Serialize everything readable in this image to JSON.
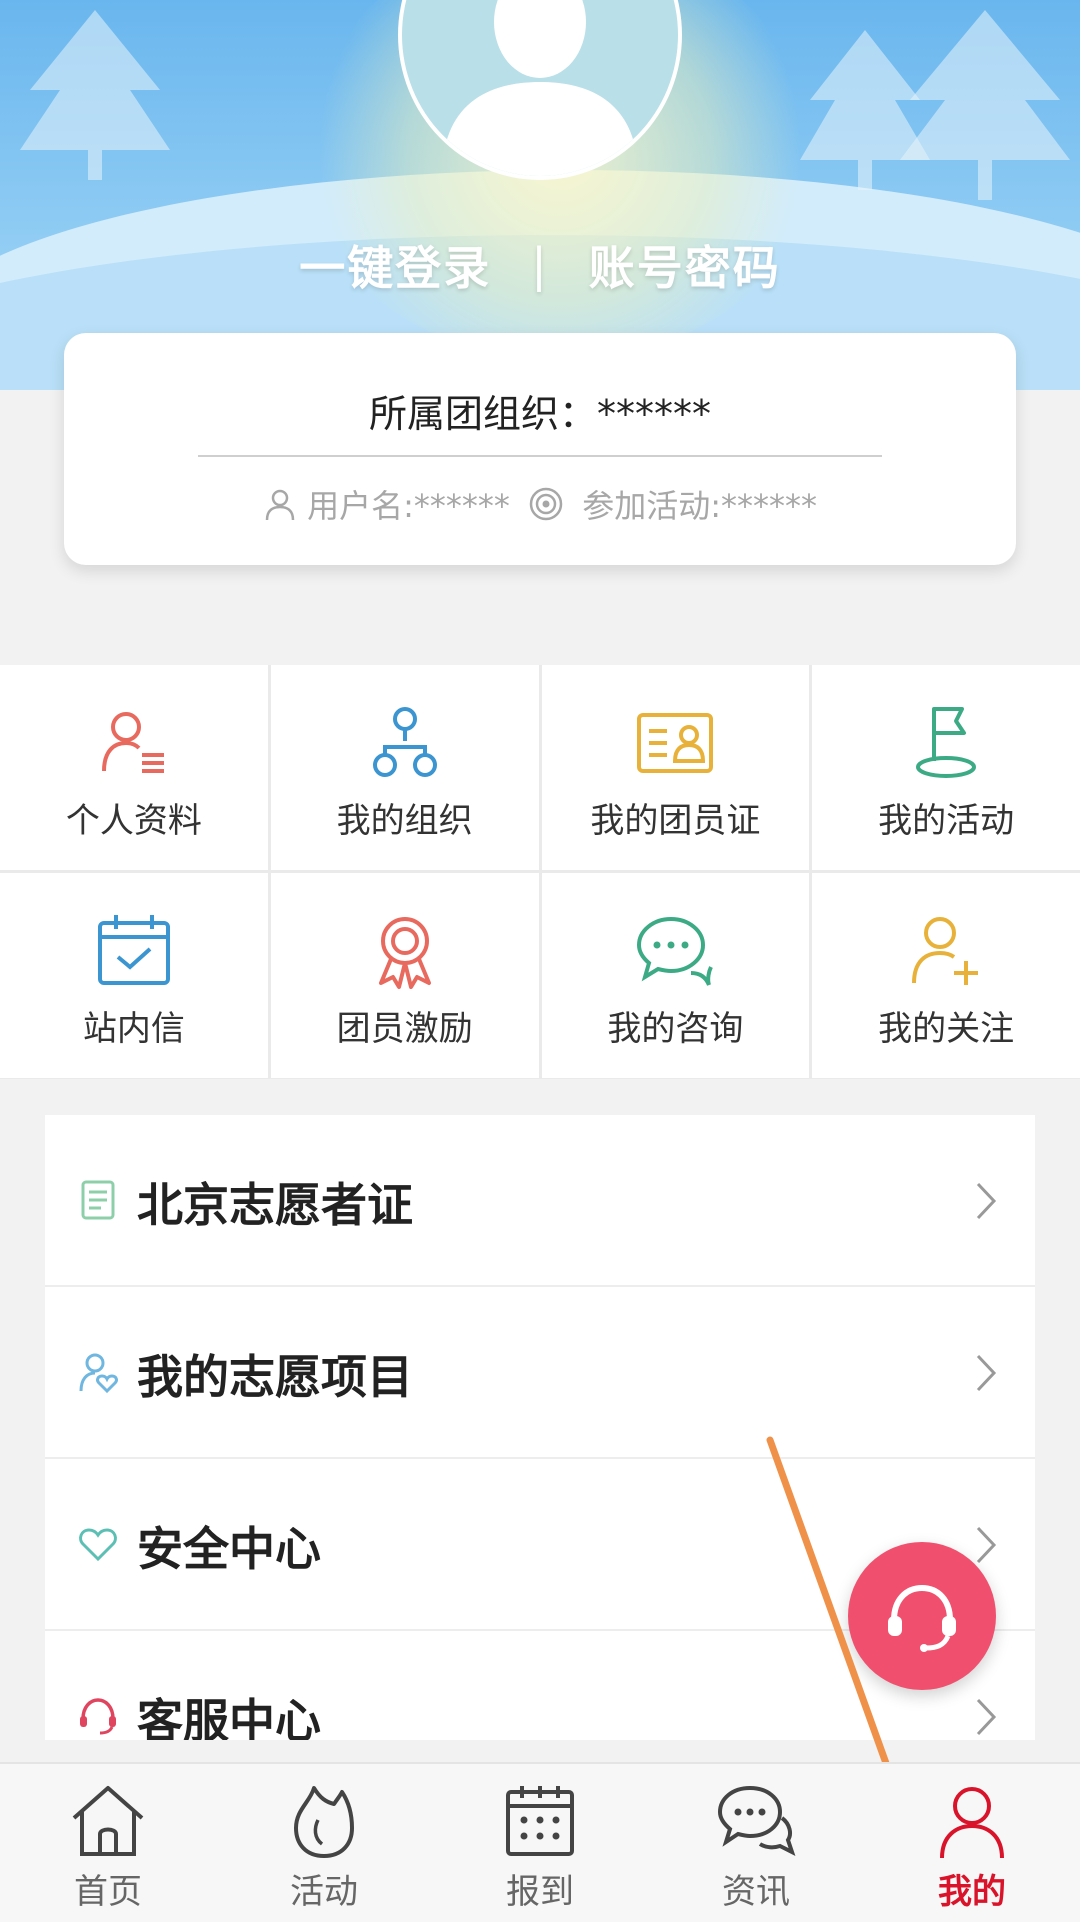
{
  "header": {
    "login_one_click": "一键登录",
    "separator": "|",
    "login_password": "账号密码"
  },
  "info_card": {
    "org_label": "所属团组织：",
    "org_value": "******",
    "username_label": "用户名:******",
    "activities_label": "参加活动:******"
  },
  "grid": [
    {
      "label": "个人资料",
      "icon": "profile-icon",
      "color": "#e86a5e"
    },
    {
      "label": "我的组织",
      "icon": "organization-icon",
      "color": "#3b95d0"
    },
    {
      "label": "我的团员证",
      "icon": "member-card-icon",
      "color": "#e8b23a"
    },
    {
      "label": "我的活动",
      "icon": "flag-icon",
      "color": "#3cab85"
    },
    {
      "label": "站内信",
      "icon": "calendar-check-icon",
      "color": "#3b95d0"
    },
    {
      "label": "团员激励",
      "icon": "medal-icon",
      "color": "#e86a5e"
    },
    {
      "label": "我的咨询",
      "icon": "chat-icon",
      "color": "#3cab85"
    },
    {
      "label": "我的关注",
      "icon": "add-user-icon",
      "color": "#e8b23a"
    }
  ],
  "list": [
    {
      "label": "北京志愿者证",
      "icon": "document-icon",
      "color": "#8ccfa8"
    },
    {
      "label": "我的志愿项目",
      "icon": "volunteer-icon",
      "color": "#6fb6e0"
    },
    {
      "label": "安全中心",
      "icon": "heart-icon",
      "color": "#5cbfb4"
    },
    {
      "label": "客服中心",
      "icon": "headset-icon",
      "color": "#e0455f"
    }
  ],
  "tabs": [
    {
      "label": "首页",
      "icon": "home-icon"
    },
    {
      "label": "活动",
      "icon": "flame-icon"
    },
    {
      "label": "报到",
      "icon": "calendar-icon"
    },
    {
      "label": "资讯",
      "icon": "news-chat-icon"
    },
    {
      "label": "我的",
      "icon": "user-icon",
      "active": true
    }
  ],
  "colors": {
    "accent": "#d9142a",
    "fab": "#f0506e",
    "annotation_arrow": "#f0914a"
  }
}
